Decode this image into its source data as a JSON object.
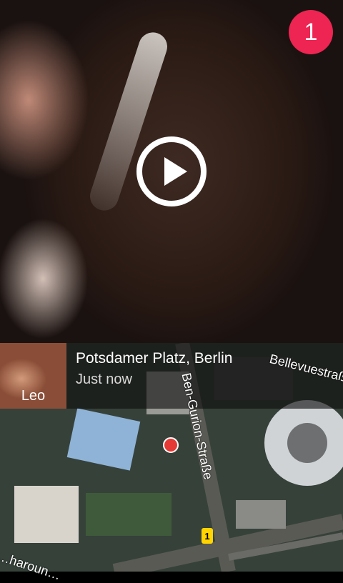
{
  "badge": {
    "count": "1"
  },
  "player": {
    "action": "Play"
  },
  "thumbnail": {
    "label": "Leo"
  },
  "place": {
    "name": "Potsdamer Platz, Berlin",
    "time": "Just now"
  },
  "map": {
    "street_1": "Ben-Gurion-Straße",
    "street_2": "Bellevuestraße",
    "street_3": "…haroun…",
    "marker_label": "1"
  },
  "colors": {
    "badge": "#ee2452",
    "pin": "#e53935",
    "marker": "#ffd400"
  }
}
